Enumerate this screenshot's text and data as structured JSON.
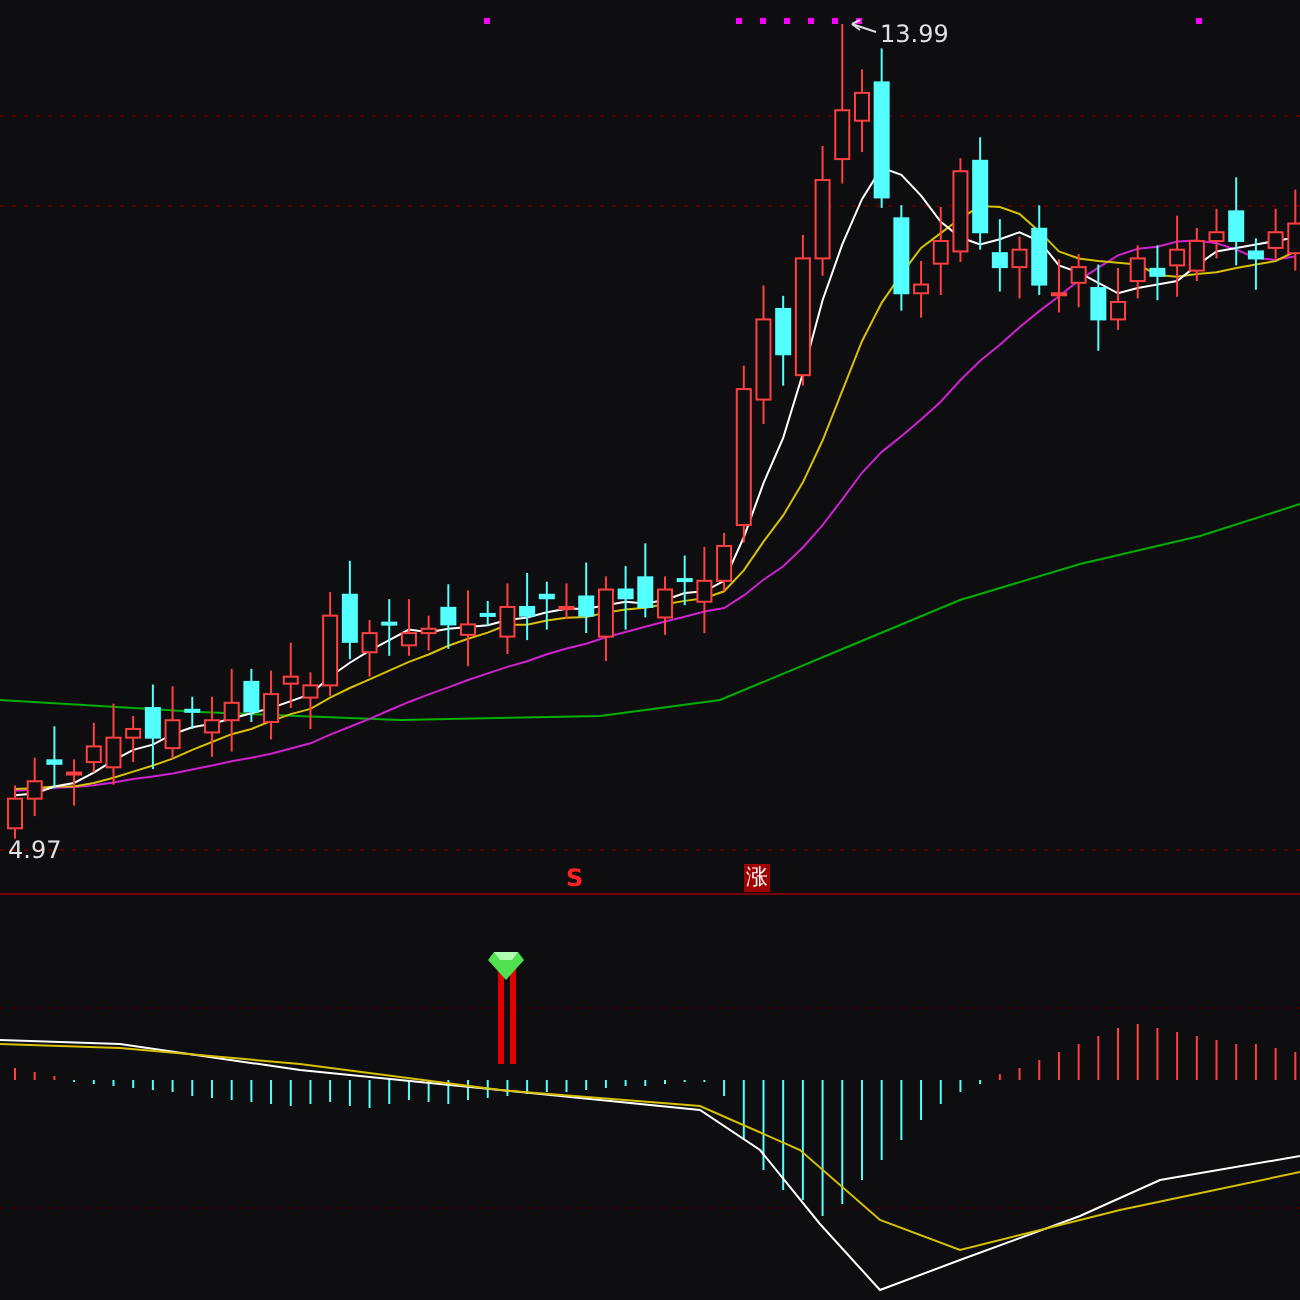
{
  "chart": {
    "high_label": "13.99",
    "low_label": "4.97"
  },
  "signals": [
    {
      "kind": "buy",
      "text": "S"
    },
    {
      "kind": "rise",
      "text": "涨"
    }
  ]
}
